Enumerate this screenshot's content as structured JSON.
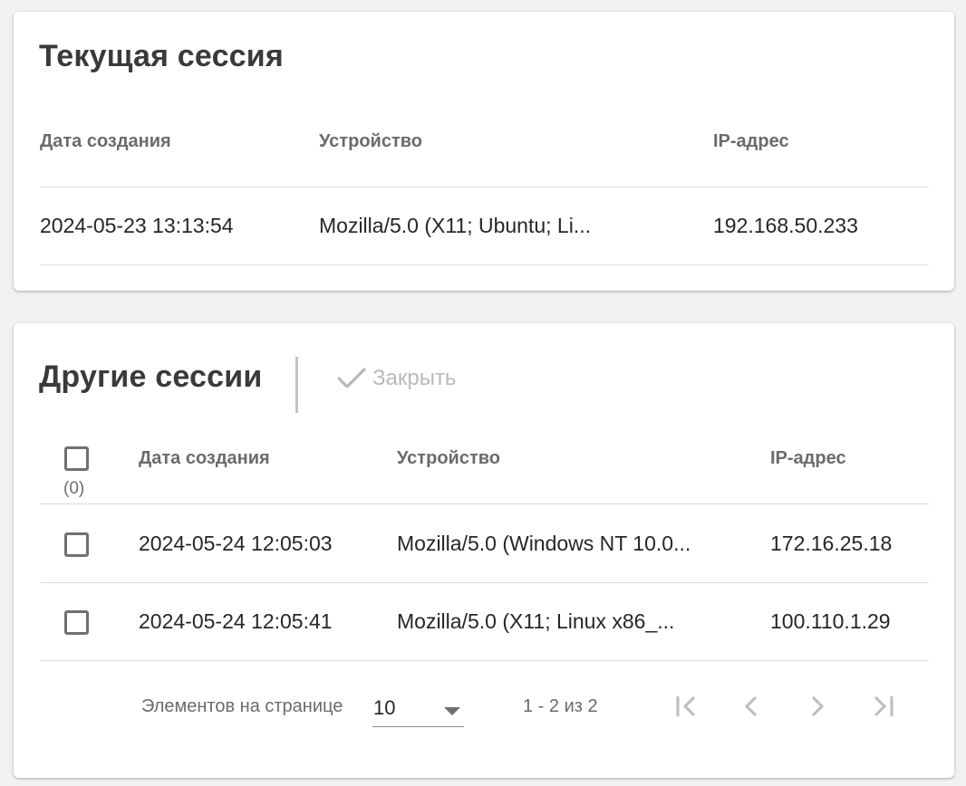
{
  "current_session": {
    "title": "Текущая сессия",
    "columns": [
      "Дата создания",
      "Устройство",
      "IP-адрес"
    ],
    "row": {
      "created": "2024-05-23 13:13:54",
      "device": "Mozilla/5.0 (X11; Ubuntu; Li...",
      "ip": "192.168.50.233"
    }
  },
  "other_sessions": {
    "title": "Другие сессии",
    "close_label": "Закрыть",
    "selected_count": "(0)",
    "columns": [
      "Дата создания",
      "Устройство",
      "IP-адрес"
    ],
    "rows": [
      {
        "created": "2024-05-24 12:05:03",
        "device": "Mozilla/5.0 (Windows NT 10.0...",
        "ip": "172.16.25.18"
      },
      {
        "created": "2024-05-24 12:05:41",
        "device": "Mozilla/5.0 (X11; Linux x86_...",
        "ip": "100.110.1.29"
      }
    ],
    "paginator": {
      "page_size_label": "Элементов на странице",
      "page_size": "10",
      "range": "1 - 2 из 2",
      "icons": [
        "first-page-icon",
        "prev-page-icon",
        "next-page-icon",
        "last-page-icon"
      ]
    }
  },
  "colors": {
    "background": "#f1f1f1",
    "card": "#ffffff",
    "disabled": "#b9b9b9",
    "header_text": "#6b6b6b"
  }
}
